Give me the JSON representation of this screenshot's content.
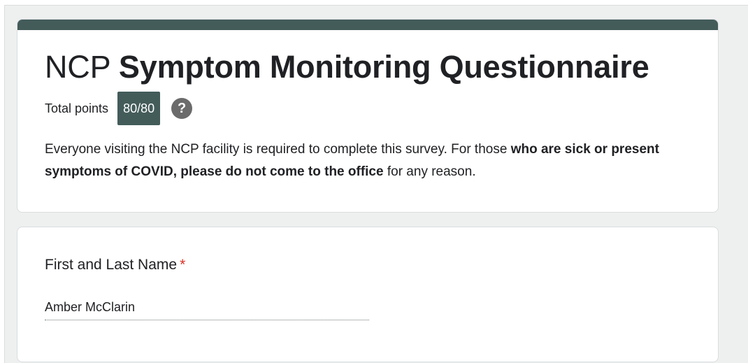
{
  "form": {
    "title_prefix": "NCP",
    "title_main": "Symptom Monitoring Questionnaire",
    "points_label": "Total points",
    "points_value": "80/80",
    "help_icon": "question-circle-icon",
    "description": {
      "part1": "Everyone visiting the NCP facility is required to complete this survey. For those ",
      "bold1": "who are sick or present symptoms of COVID, please do not come to the office",
      "part2": " for any reason."
    },
    "accent_color": "#435c5a"
  },
  "questions": [
    {
      "title": "First and Last Name",
      "required_marker": "*",
      "answer": "Amber McClarin"
    }
  ]
}
